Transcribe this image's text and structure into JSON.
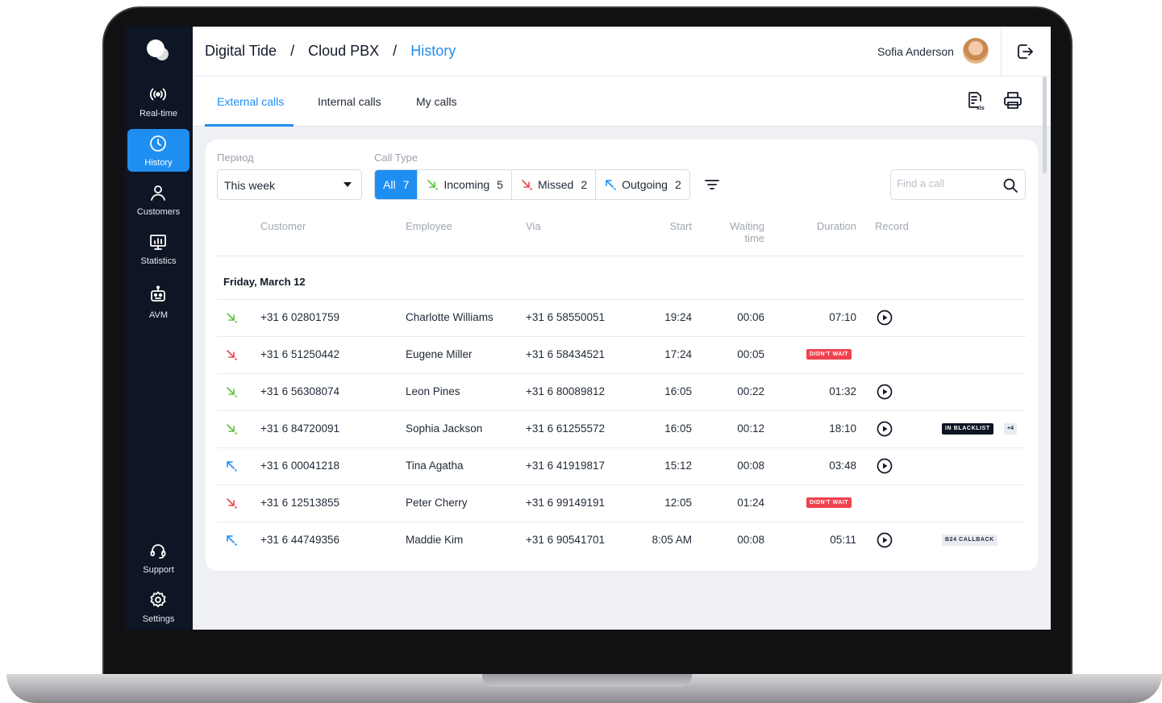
{
  "breadcrumb": {
    "root": "Digital Tide",
    "sep": "/",
    "section": "Cloud PBX",
    "current": "History"
  },
  "user": {
    "name": "Sofia Anderson"
  },
  "sidebar": {
    "items": [
      {
        "id": "realtime",
        "label": "Real-time",
        "icon": "broadcast-icon"
      },
      {
        "id": "history",
        "label": "History",
        "icon": "clock-icon",
        "active": true
      },
      {
        "id": "customers",
        "label": "Customers",
        "icon": "person-icon"
      },
      {
        "id": "statistics",
        "label": "Statistics",
        "icon": "chart-icon"
      },
      {
        "id": "avm",
        "label": "AVM",
        "icon": "robot-icon"
      }
    ],
    "bottom": [
      {
        "id": "support",
        "label": "Support",
        "icon": "headset-icon"
      },
      {
        "id": "settings",
        "label": "Settings",
        "icon": "gear-icon"
      }
    ]
  },
  "tabs": [
    "External calls",
    "Internal calls",
    "My calls"
  ],
  "filters": {
    "period_label": "Период",
    "period_value": "This week",
    "calltype_label": "Call Type",
    "types": [
      {
        "label": "All",
        "count": "7",
        "active": true
      },
      {
        "label": "Incoming",
        "count": "5"
      },
      {
        "label": "Missed",
        "count": "2"
      },
      {
        "label": "Outgoing",
        "count": "2"
      }
    ],
    "search_placeholder": "Find a call"
  },
  "table": {
    "headers": {
      "customer": "Customer",
      "employee": "Employee",
      "via": "Via",
      "start": "Start",
      "waiting1": "Waiting",
      "waiting2": "time",
      "duration": "Duration",
      "record": "Record"
    },
    "group": "Friday, March 12",
    "rows": [
      {
        "dir": "incoming",
        "customer": "+31 6 02801759",
        "employee": "Charlotte Williams",
        "via": "+31 6 58550051",
        "start": "19:24",
        "wait": "00:06",
        "duration": "07:10",
        "record": true
      },
      {
        "dir": "missed",
        "customer": "+31 6 51250442",
        "employee": "Eugene Miller",
        "via": "+31 6 58434521",
        "start": "17:24",
        "wait": "00:05",
        "badge": "DIDN'T WAIT"
      },
      {
        "dir": "incoming",
        "customer": "+31 6 56308074",
        "employee": "Leon Pines",
        "via": "+31 6 80089812",
        "start": "16:05",
        "wait": "00:22",
        "duration": "01:32",
        "record": true
      },
      {
        "dir": "incoming",
        "customer": "+31 6 84720091",
        "employee": "Sophia Jackson",
        "via": "+31 6 61255572",
        "start": "16:05",
        "wait": "00:12",
        "duration": "18:10",
        "record": true,
        "tag": "IN BLACKLIST",
        "more": "+4"
      },
      {
        "dir": "outgoing",
        "customer": "+31 6 00041218",
        "employee": "Tina Agatha",
        "via": "+31 6 41919817",
        "start": "15:12",
        "wait": "00:08",
        "duration": "03:48",
        "record": true
      },
      {
        "dir": "missed",
        "customer": "+31 6 12513855",
        "employee": "Peter Cherry",
        "via": "+31 6 99149191",
        "start": "12:05",
        "wait": "01:24",
        "badge": "DIDN'T WAIT"
      },
      {
        "dir": "outgoing",
        "customer": "+31 6 44749356",
        "employee": "Maddie Kim",
        "via": "+31 6 90541701",
        "start": "8:05 AM",
        "wait": "00:08",
        "duration": "05:11",
        "record": true,
        "tag_light": "B24 CALLBACK"
      }
    ]
  },
  "colors": {
    "accent": "#1f8ef1",
    "incoming": "#5cc43a",
    "missed": "#f0424f",
    "outgoing": "#1f8ef1",
    "sidebar": "#0e1524"
  }
}
